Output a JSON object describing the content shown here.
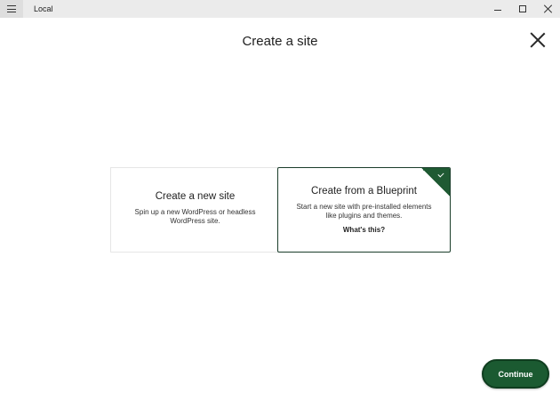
{
  "window": {
    "app_title": "Local"
  },
  "modal": {
    "title": "Create a site"
  },
  "cards": {
    "new_site": {
      "title": "Create a new site",
      "description": "Spin up a new WordPress or headless WordPress site.",
      "selected": false
    },
    "blueprint": {
      "title": "Create from a Blueprint",
      "description": "Start a new site with pre-installed elements like plugins and themes.",
      "link_text": "What's this?",
      "selected": true
    }
  },
  "footer": {
    "continue_label": "Continue"
  },
  "colors": {
    "accent": "#1b5a31",
    "accent_dark": "#0f3d1f",
    "titlebar": "#ebebeb"
  },
  "icons": [
    "menu-icon",
    "minimize-icon",
    "maximize-icon",
    "window-close-icon",
    "close-icon",
    "checkmark-icon"
  ]
}
